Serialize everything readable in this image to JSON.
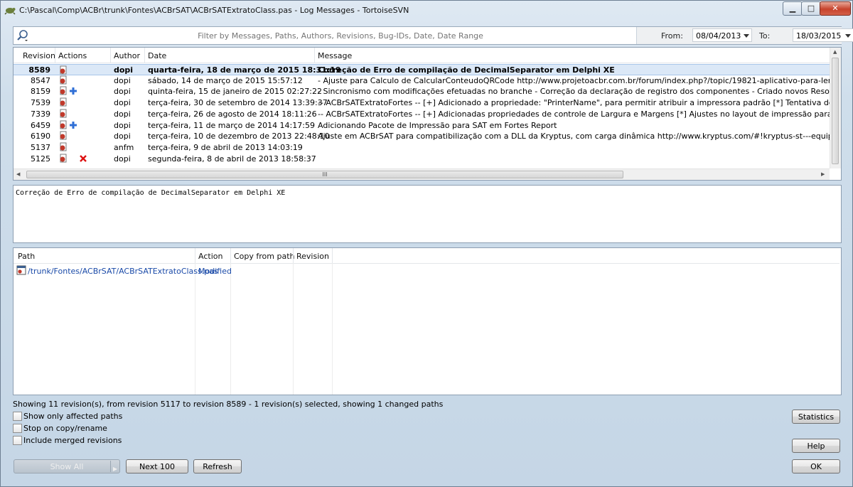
{
  "window": {
    "title": "C:\\Pascal\\Comp\\ACBr\\trunk\\Fontes\\ACBrSAT\\ACBrSATExtratoClass.pas - Log Messages - TortoiseSVN",
    "minimize": "▁",
    "maximize": "□",
    "close": "✕"
  },
  "filter": {
    "placeholder": "Filter by Messages, Paths, Authors, Revisions, Bug-IDs, Date, Date Range",
    "from_label": "From:",
    "from_value": "08/04/2013",
    "to_label": "To:",
    "to_value": "18/03/2015"
  },
  "log": {
    "columns": [
      "Revision",
      "Actions",
      "Author",
      "Date",
      "Message"
    ],
    "rows": [
      {
        "revision": "8589",
        "actions": [
          "modified"
        ],
        "author": "dopi",
        "date": "quarta-feira, 18 de março de 2015 18:31:19",
        "message": "Correção de Erro de compilação de DecimalSeparator em Delphi XE",
        "selected": true
      },
      {
        "revision": "8547",
        "actions": [
          "modified"
        ],
        "author": "dopi",
        "date": "sábado, 14 de março de 2015 15:57:12",
        "message": "- Ajuste para Calculo de CalcularConteudoQRCode http://www.projetoacbr.com.br/forum/index.php?/topic/19821-aplicativo-para-ler-qrcode-do-sat-na-google-pl"
      },
      {
        "revision": "8159",
        "actions": [
          "modified",
          "added"
        ],
        "author": "dopi",
        "date": "quinta-feira, 15 de janeiro de 2015 02:27:22",
        "message": "- Sincronismo com modificações efetuadas no branche - Correção da declaração de registro dos componentes  - Criado novos Resources de Imagem para Virtual e"
      },
      {
        "revision": "7539",
        "actions": [
          "modified"
        ],
        "author": "dopi",
        "date": "terça-feira, 30 de setembro de 2014 13:39:37",
        "message": "-- ACBrSATExtratoFortes -- [+] Adicionado a propriedade: \"PrinterName\", para permitir atribuir a impressora    padrão [*] Tentativa de ajuste para correção de in"
      },
      {
        "revision": "7339",
        "actions": [
          "modified"
        ],
        "author": "dopi",
        "date": "terça-feira, 26 de agosto de 2014 18:11:26",
        "message": "-- ACBrSATExtratoFortes -- [+] Adicionadas propriedades de controle de Largura e Margens [*] Ajustes no layout de impressão para suportar mudanças de Marge"
      },
      {
        "revision": "6459",
        "actions": [
          "modified",
          "added"
        ],
        "author": "dopi",
        "date": "terça-feira, 11 de março de 2014 14:17:59",
        "message": "Adicionando Pacote de Impressão para SAT em Fortes Report"
      },
      {
        "revision": "6190",
        "actions": [
          "modified"
        ],
        "author": "dopi",
        "date": "terça-feira, 10 de dezembro de 2013 22:48:10",
        "message": "Ajuste em ACBrSAT para compatibilização com a DLL da Kryptus, com carga dinâmica http://www.kryptus.com/#!kryptus-st---equipamento-cf-e-sat-/c1gcz Remoç"
      },
      {
        "revision": "5137",
        "actions": [
          "modified"
        ],
        "author": "anfm",
        "date": "terça-feira, 9 de abril de 2013 14:03:19",
        "message": ""
      },
      {
        "revision": "5125",
        "actions": [
          "modified",
          "deleted"
        ],
        "author": "dopi",
        "date": "segunda-feira, 8 de abril de 2013 18:58:37",
        "message": ""
      }
    ],
    "hscroll_grip": "III"
  },
  "message_text": "Correção de Erro de compilação de DecimalSeparator em Delphi XE",
  "paths": {
    "columns": [
      "Path",
      "Action",
      "Copy from path",
      "Revision"
    ],
    "rows": [
      {
        "path": "/trunk/Fontes/ACBrSAT/ACBrSATExtratoClass.pas",
        "action": "Modified",
        "copy_from": "",
        "revision": ""
      }
    ]
  },
  "status": "Showing 11 revision(s), from revision 5117 to revision 8589 - 1 revision(s) selected, showing 1 changed paths",
  "options": {
    "show_only_affected": "Show only affected paths",
    "stop_on_copy": "Stop on copy/rename",
    "include_merged": "Include merged revisions"
  },
  "buttons": {
    "show_all": "Show All",
    "next100": "Next 100",
    "refresh": "Refresh",
    "statistics": "Statistics",
    "help": "Help",
    "ok": "OK"
  },
  "colors": {
    "selection": "#dbe8f7",
    "modified_icon": "#c0392b",
    "added_icon": "#2f6fd6",
    "path_text": "#1a4aa8"
  }
}
